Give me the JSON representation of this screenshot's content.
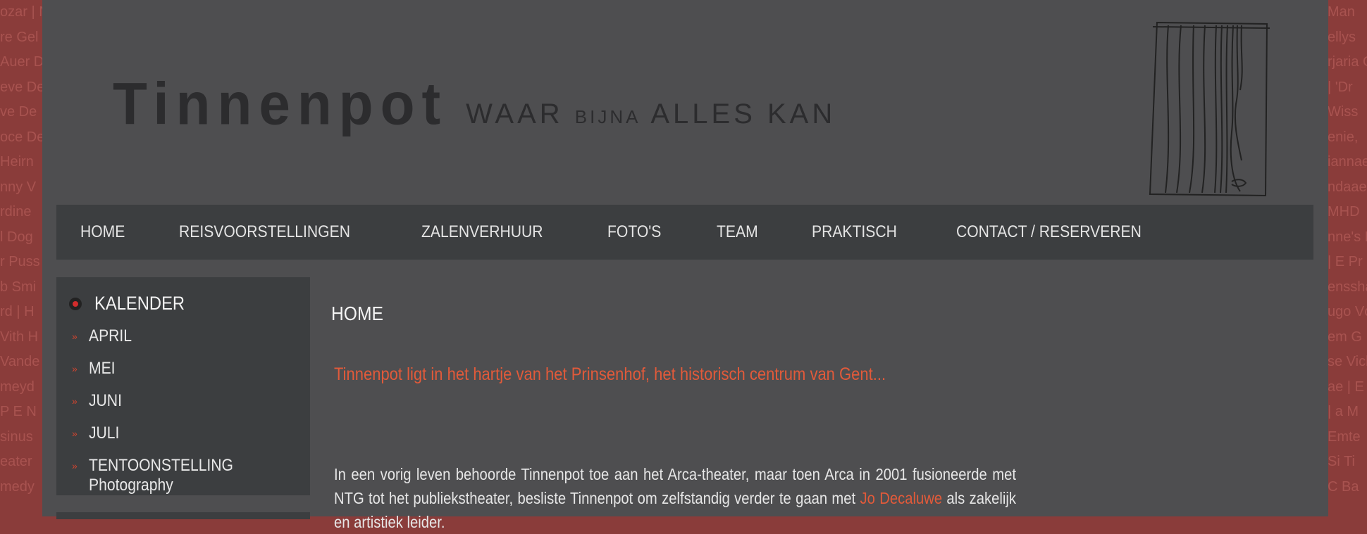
{
  "background": {
    "left_fragments": [
      "ozar | N",
      "re Gel",
      "Auer D",
      "eve De",
      "ve De",
      "oce De",
      "Heirn",
      "nny V",
      "rdine",
      "l Dog",
      "r Puss",
      "b Smi",
      "rd | H",
      "Vith H",
      "Vande",
      "meyd",
      "P E N",
      "sinus",
      "eater",
      "medy"
    ],
    "right_fragments": [
      "Man",
      "ellys",
      "rjaria O",
      "| 'Dr",
      "Wiss",
      "enie,",
      "iannae",
      "ndaae",
      "MHD",
      "nne's D",
      "| E Pr",
      "enssha",
      "ugo Vc",
      "em G",
      "se Vick",
      "ae | E",
      "| a M",
      "Emte",
      "Si Ti",
      "C Ba"
    ]
  },
  "header": {
    "logo_name": "Tinnenpot",
    "tag_part1": "WAAR",
    "tag_part2": "BIJNA",
    "tag_part3": "ALLES KAN",
    "curtain_icon": "curtain-icon"
  },
  "nav": {
    "items": [
      "HOME",
      "REISVOORSTELLINGEN",
      "ZALENVERHUUR",
      "FOTO'S",
      "TEAM",
      "PRAKTISCH",
      "CONTACT / RESERVEREN"
    ]
  },
  "sidebar": {
    "title": "KALENDER",
    "items": [
      {
        "label": "APRIL"
      },
      {
        "label": "MEI"
      },
      {
        "label": "JUNI"
      },
      {
        "label": "JULI"
      },
      {
        "label": "TENTOONSTELLING",
        "sub": "Photography"
      }
    ]
  },
  "main": {
    "heading": "HOME",
    "intro": "Tinnenpot ligt in het hartje van het Prinsenhof, het historisch centrum van Gent...",
    "paragraph_before_link": "In een vorig leven behoorde Tinnenpot toe aan het Arca-theater, maar toen Arca in 2001 fusioneerde met NTG tot het publiekstheater, besliste Tinnenpot om zelfstandig verder te gaan met ",
    "link_text": "Jo Decaluwe",
    "paragraph_after_link": " als zakelijk en artistiek leider."
  },
  "colors": {
    "page_bg": "#4e4e50",
    "nav_bg": "#3c3e40",
    "accent": "#e25a3a",
    "outer_bg": "#8a3c3a"
  }
}
